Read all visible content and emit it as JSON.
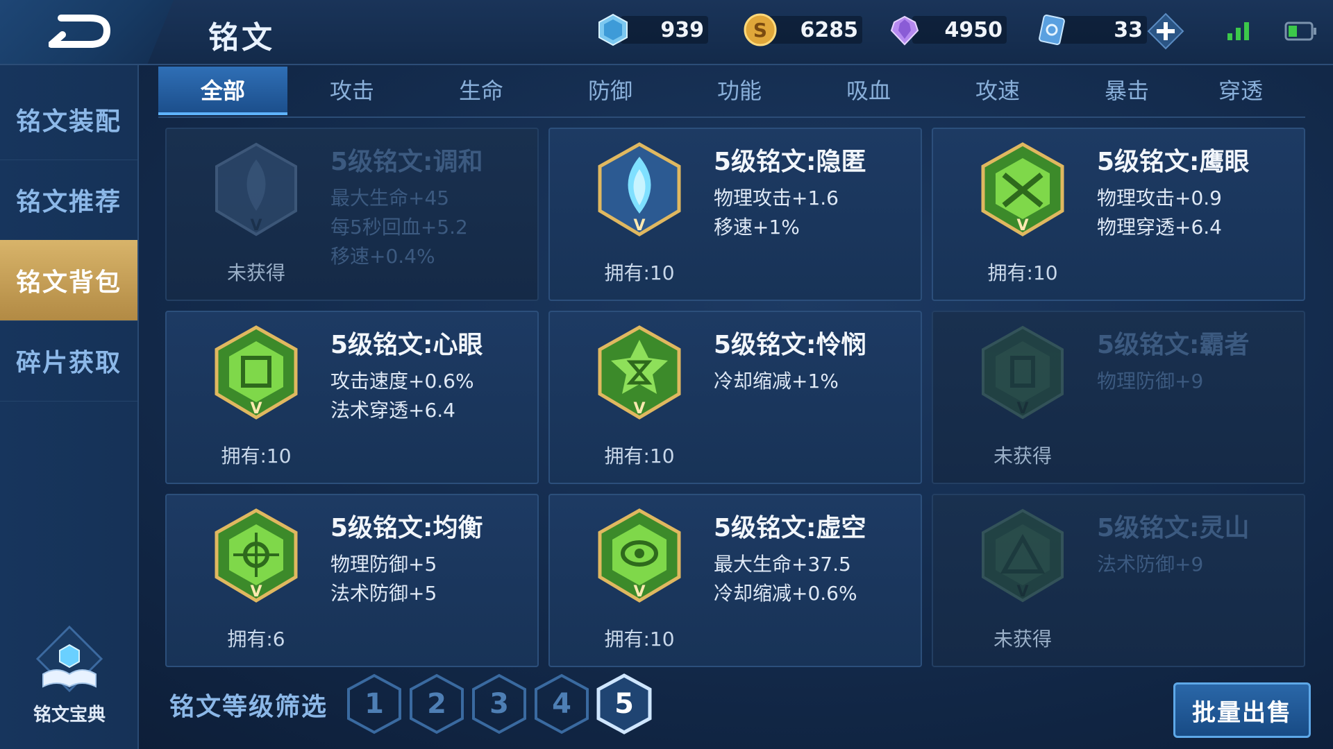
{
  "header": {
    "title": "铭文",
    "currencies": [
      {
        "icon": "diamond-icon",
        "value": "939"
      },
      {
        "icon": "gold-coin-icon",
        "value": "6285"
      },
      {
        "icon": "purple-crystal-icon",
        "value": "4950"
      },
      {
        "icon": "coupon-icon",
        "value": "33"
      }
    ]
  },
  "sidebar": {
    "items": [
      {
        "label": "铭文装配"
      },
      {
        "label": "铭文推荐"
      },
      {
        "label": "铭文背包"
      },
      {
        "label": "碎片获取"
      }
    ],
    "active_index": 2,
    "codex_label": "铭文宝典"
  },
  "tabs": [
    {
      "label": "全部"
    },
    {
      "label": "攻击"
    },
    {
      "label": "生命"
    },
    {
      "label": "防御"
    },
    {
      "label": "功能"
    },
    {
      "label": "吸血"
    },
    {
      "label": "攻速"
    },
    {
      "label": "暴击"
    },
    {
      "label": "穿透"
    }
  ],
  "active_tab": 0,
  "cards": [
    {
      "name": "5级铭文:调和",
      "stats": [
        "最大生命+45",
        "每5秒回血+5.2",
        "移速+0.4%"
      ],
      "owned": "未获得",
      "locked": true,
      "color": "blue-grey"
    },
    {
      "name": "5级铭文:隐匿",
      "stats": [
        "物理攻击+1.6",
        "移速+1%"
      ],
      "owned": "拥有:10",
      "locked": false,
      "color": "blue"
    },
    {
      "name": "5级铭文:鹰眼",
      "stats": [
        "物理攻击+0.9",
        "物理穿透+6.4"
      ],
      "owned": "拥有:10",
      "locked": false,
      "color": "green"
    },
    {
      "name": "5级铭文:心眼",
      "stats": [
        "攻击速度+0.6%",
        "法术穿透+6.4"
      ],
      "owned": "拥有:10",
      "locked": false,
      "color": "green"
    },
    {
      "name": "5级铭文:怜悯",
      "stats": [
        "冷却缩减+1%"
      ],
      "owned": "拥有:10",
      "locked": false,
      "color": "green"
    },
    {
      "name": "5级铭文:霸者",
      "stats": [
        "物理防御+9"
      ],
      "owned": "未获得",
      "locked": true,
      "color": "green"
    },
    {
      "name": "5级铭文:均衡",
      "stats": [
        "物理防御+5",
        "法术防御+5"
      ],
      "owned": "拥有:6",
      "locked": false,
      "color": "green"
    },
    {
      "name": "5级铭文:虚空",
      "stats": [
        "最大生命+37.5",
        "冷却缩减+0.6%"
      ],
      "owned": "拥有:10",
      "locked": false,
      "color": "green"
    },
    {
      "name": "5级铭文:灵山",
      "stats": [
        "法术防御+9"
      ],
      "owned": "未获得",
      "locked": true,
      "color": "green"
    }
  ],
  "filter": {
    "label": "铭文等级筛选",
    "levels": [
      "1",
      "2",
      "3",
      "4",
      "5"
    ],
    "active_level": "5"
  },
  "bulk_sell_label": "批量出售",
  "colors": {
    "accent": "#2f6fb6",
    "gold_tab": "#d8b46a",
    "green_gem": "#6fcf3a",
    "blue_gem": "#5fd0ff"
  }
}
